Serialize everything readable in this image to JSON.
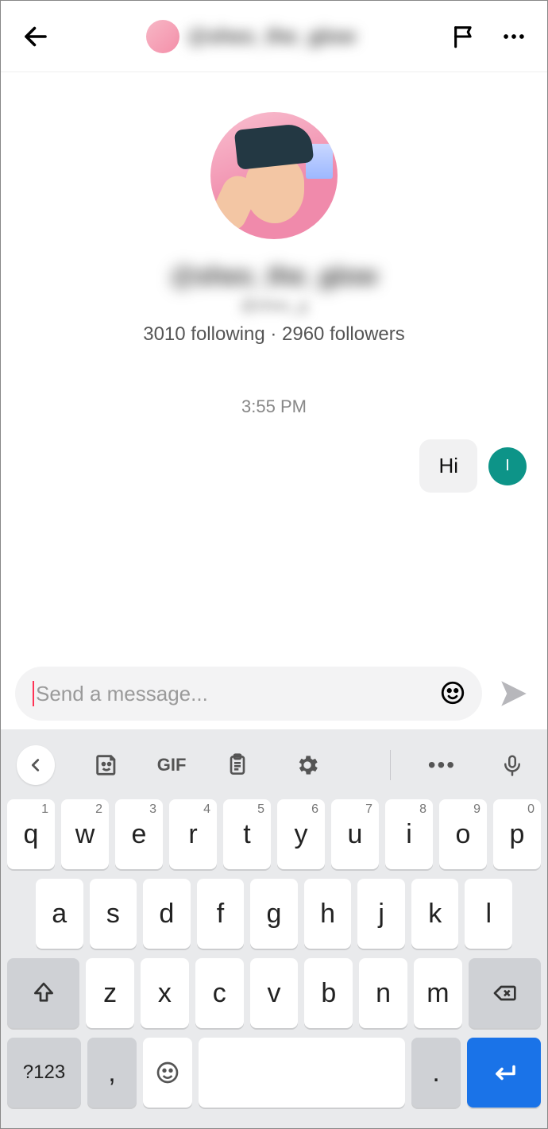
{
  "header": {
    "username": "@shes_the_glow",
    "flag_label": "Report",
    "more_label": "More"
  },
  "profile": {
    "username": "@shes_the_glow",
    "handle": "@shes_g",
    "following_count": "3010",
    "following_label": "following",
    "followers_count": "2960",
    "followers_label": "followers",
    "stats_text": "3010 following · 2960 followers"
  },
  "chat": {
    "timestamp": "3:55 PM",
    "messages": [
      {
        "from": "me",
        "text": "Hi",
        "avatar_initial": "I"
      }
    ]
  },
  "composer": {
    "placeholder": "Send a message...",
    "value": ""
  },
  "keyboard": {
    "toolbar": {
      "back": "‹",
      "sticker": "sticker",
      "gif": "GIF",
      "clipboard": "clipboard",
      "settings": "settings",
      "more": "•••",
      "mic": "mic"
    },
    "row1": [
      {
        "k": "q",
        "n": "1"
      },
      {
        "k": "w",
        "n": "2"
      },
      {
        "k": "e",
        "n": "3"
      },
      {
        "k": "r",
        "n": "4"
      },
      {
        "k": "t",
        "n": "5"
      },
      {
        "k": "y",
        "n": "6"
      },
      {
        "k": "u",
        "n": "7"
      },
      {
        "k": "i",
        "n": "8"
      },
      {
        "k": "o",
        "n": "9"
      },
      {
        "k": "p",
        "n": "0"
      }
    ],
    "row2": [
      "a",
      "s",
      "d",
      "f",
      "g",
      "h",
      "j",
      "k",
      "l"
    ],
    "row3": [
      "z",
      "x",
      "c",
      "v",
      "b",
      "n",
      "m"
    ],
    "sym_label": "?123",
    "comma": ",",
    "period": "."
  }
}
